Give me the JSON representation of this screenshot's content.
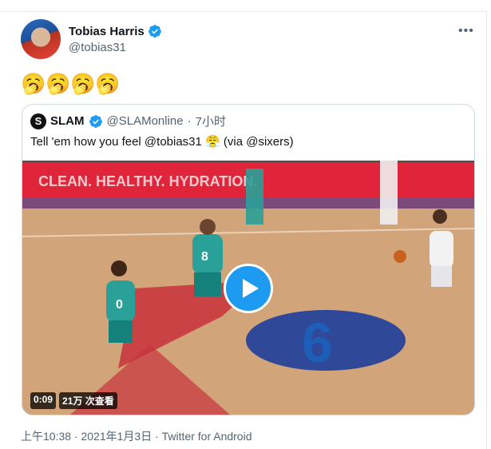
{
  "author": {
    "name": "Tobias Harris",
    "handle": "@tobias31",
    "verified": true
  },
  "tweet": {
    "text": "🥱🥱🥱🥱",
    "timestamp": "上午10:38 · 2021年1月3日",
    "client": "Twitter for Android"
  },
  "quoted": {
    "avatar_letter": "S",
    "name": "SLAM",
    "handle": "@SLAMonline",
    "time": "7小时",
    "text": "Tell 'em how you feel @tobias31 😤 (via @sixers)",
    "video": {
      "duration": "0:09",
      "views": "21万 次查看",
      "court_text": "CLEAN. HEALTHY. HYDRATION.",
      "floor_number": "6",
      "jersey_1": "8",
      "jersey_2": "0"
    }
  },
  "colors": {
    "accent": "#1d9bf0",
    "text_secondary": "#536471",
    "border": "#cfd9de"
  },
  "icons": [
    "verified-badge-icon",
    "more-options-icon",
    "play-icon"
  ]
}
